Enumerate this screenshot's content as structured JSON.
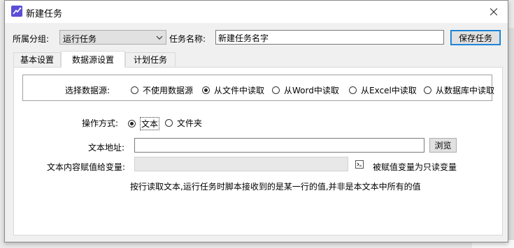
{
  "window": {
    "title": "新建任务"
  },
  "header": {
    "group_label": "所属分组:",
    "group_value": "运行任务",
    "name_label": "任务名称:",
    "name_value": "新建任务名字",
    "save_button": "保存任务"
  },
  "tabs": [
    {
      "label": "基本设置",
      "active": false
    },
    {
      "label": "数据源设置",
      "active": true
    },
    {
      "label": "计划任务",
      "active": false
    }
  ],
  "source": {
    "label": "选择数据源:",
    "options": [
      {
        "label": "不使用数据源",
        "checked": false
      },
      {
        "label": "从文件中读取",
        "checked": true
      },
      {
        "label": "从Word中读取",
        "checked": false
      },
      {
        "label": "从Excel中读取",
        "checked": false
      },
      {
        "label": "从数据库中读取",
        "checked": false
      }
    ]
  },
  "operation": {
    "label": "操作方式:",
    "options": [
      {
        "label": "文本",
        "checked": true
      },
      {
        "label": "文件夹",
        "checked": false
      }
    ]
  },
  "file": {
    "address_label": "文本地址:",
    "address_value": "",
    "browse_button": "浏览",
    "variable_label": "文本内容赋值给变量:",
    "variable_value": "",
    "variable_note": "被赋值变量为只读变量",
    "variable_icon": "variable-insert-icon"
  },
  "hint": "按行读取文本,运行任务时脚本接收到的是某一行的值,并非是本文本中所有的值",
  "colors": {
    "accent": "#0078d7",
    "app_icon": "#5b4dd6"
  }
}
